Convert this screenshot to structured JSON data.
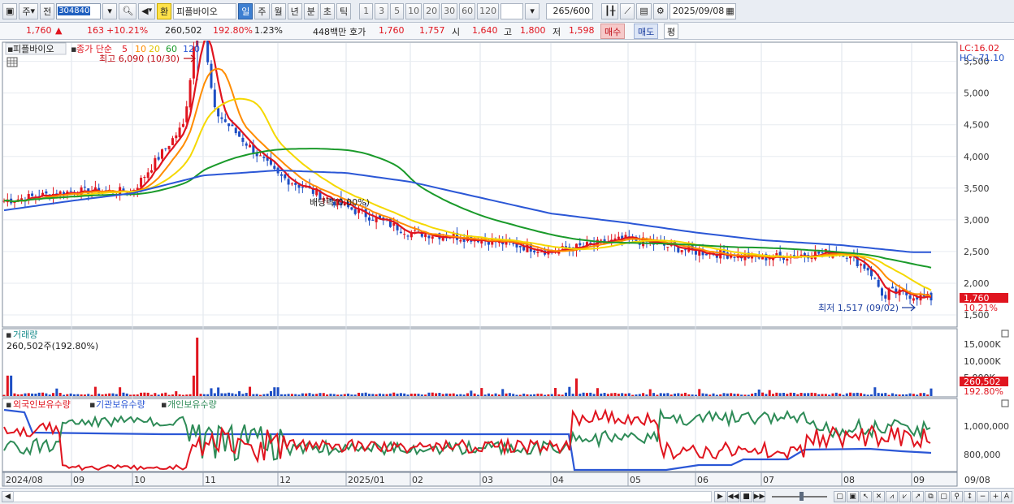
{
  "toolbar": {
    "market_label": "주",
    "prev_label": "전",
    "code_value": "304840",
    "dividend_badge": "환",
    "stock_name": "피플바이오",
    "period_day": "일",
    "period_week": "주",
    "period_month": "월",
    "period_year": "년",
    "period_minute": "분",
    "period_second": "초",
    "period_tick": "틱",
    "intervals": [
      "1",
      "3",
      "5",
      "10",
      "20",
      "30",
      "60",
      "120"
    ],
    "count_value": "265",
    "count_total": "/600",
    "date_value": "2025/09/08"
  },
  "quote": {
    "price": "1,760",
    "change_arrow": "▲",
    "change": "163",
    "change_pct": "+10.21%",
    "volume": "260,502",
    "volume_ratio": "192.80%",
    "turnover": "1.23%",
    "amount": "448백만",
    "ask_label": "호가",
    "ask": "1,760",
    "bid": "1,757",
    "open_label": "시",
    "open": "1,640",
    "high_label": "고",
    "high": "1,800",
    "low_label": "저",
    "low": "1,598",
    "buy_label": "매수",
    "sell_label": "매도",
    "avg_label": "평"
  },
  "price_panel": {
    "title": "피플바이오",
    "legend_prefix": "종가 단순",
    "ma_periods": [
      "5",
      "10",
      "20",
      "60",
      "120"
    ],
    "ma_colors": [
      "#e0151f",
      "#ff8c00",
      "#f5d800",
      "#1a9a2a",
      "#2b57d6"
    ],
    "high_annotation": "최고 6,090 (10/30)",
    "low_annotation": "최저 1,517 (09/02)",
    "dividend_annotation": "배당락(0.00%)",
    "lc_label": "LC:16.02",
    "hc_label": "HC:-71.10",
    "y_ticks": [
      "5,500",
      "5,000",
      "4,500",
      "4,000",
      "3,500",
      "3,000",
      "2,500",
      "2,000",
      "1,500"
    ],
    "current_tag": "1,760",
    "current_pct_tag": "10.21%"
  },
  "volume_panel": {
    "title": "거래량",
    "value_text": "260,502주(192.80%)",
    "y_ticks": [
      "15,000K",
      "10,000K",
      "5,000K"
    ],
    "current_tag": "260,502",
    "current_pct_tag": "192.80%"
  },
  "holding_panel": {
    "series_names": [
      "외국인보유수량",
      "기관보유수량",
      "개인보유수량"
    ],
    "series_colors": [
      "#e0151f",
      "#2b57d6",
      "#2e8b57"
    ],
    "y_ticks": [
      "1,000,000",
      "800,000"
    ]
  },
  "x_axis": {
    "labels": [
      "2024/08",
      "09",
      "10",
      "11",
      "12",
      "2025/01",
      "02",
      "03",
      "04",
      "05",
      "06",
      "07",
      "08",
      "09"
    ],
    "right_label": "09/08"
  },
  "chart_data": {
    "type": "line",
    "title": "피플바이오",
    "x": [
      "2024/08",
      "2024/09",
      "2024/10",
      "2024/11",
      "2024/12",
      "2025/01",
      "2025/02",
      "2025/03",
      "2025/04",
      "2025/05",
      "2025/06",
      "2025/07",
      "2025/08",
      "2025/09"
    ],
    "series": [
      {
        "name": "종가",
        "values": [
          3300,
          3450,
          3450,
          4900,
          3700,
          3200,
          2800,
          2700,
          2500,
          2700,
          2500,
          2400,
          2500,
          1760
        ]
      },
      {
        "name": "120",
        "values": [
          3150,
          3300,
          3420,
          3700,
          3780,
          3740,
          3600,
          3350,
          3100,
          2950,
          2800,
          2680,
          2600,
          2490
        ]
      }
    ],
    "ylim": [
      1500,
      5700
    ],
    "high": {
      "value": 6090,
      "date": "10/30"
    },
    "low": {
      "value": 1517,
      "date": "09/02"
    }
  },
  "icons": {
    "layout": "layout-icon",
    "search": "search-icon",
    "speaker": "speaker-icon",
    "candle": "candle-icon",
    "save": "save-icon",
    "settings": "gear-icon",
    "calendar": "calendar-icon"
  }
}
